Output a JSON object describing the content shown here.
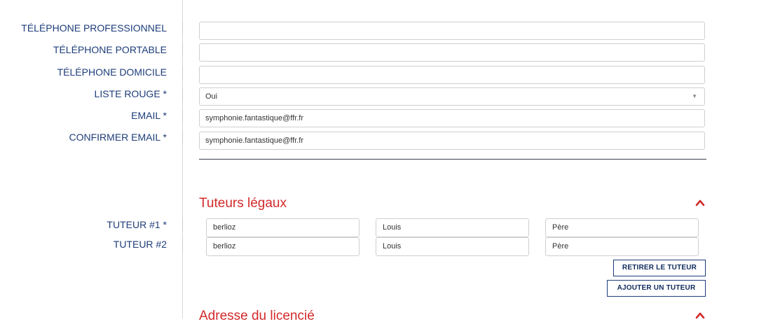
{
  "contact": {
    "telephone_pro": {
      "label": "TÉLÉPHONE PROFESSIONNEL",
      "value": ""
    },
    "telephone_portable": {
      "label": "TÉLÉPHONE PORTABLE",
      "value": ""
    },
    "telephone_domicile": {
      "label": "TÉLÉPHONE DOMICILE",
      "value": ""
    },
    "liste_rouge": {
      "label": "LISTE ROUGE *",
      "value": "Oui"
    },
    "email": {
      "label": "EMAIL *",
      "value": "symphonie.fantastique@ffr.fr"
    },
    "confirm_email": {
      "label": "CONFIRMER EMAIL *",
      "value": "symphonie.fantastique@ffr.fr"
    }
  },
  "tuteurs": {
    "title": "Tuteurs légaux",
    "items": [
      {
        "label": "TUTEUR #1 *",
        "nom": "berlioz",
        "prenom": "Louis",
        "lien": "Père"
      },
      {
        "label": "TUTEUR #2",
        "nom": "berlioz",
        "prenom": "Louis",
        "lien": "Père"
      }
    ],
    "remove_label": "RETIRER LE TUTEUR",
    "add_label": "AJOUTER UN TUTEUR"
  },
  "adresse": {
    "title": "Adresse du licencié"
  },
  "colors": {
    "label": "#1d3d7a",
    "section": "#d32a2a",
    "border": "#cfcfcf"
  },
  "icons": {
    "collapse": "chevron-up-icon",
    "dropdown": "caret-down-icon"
  }
}
